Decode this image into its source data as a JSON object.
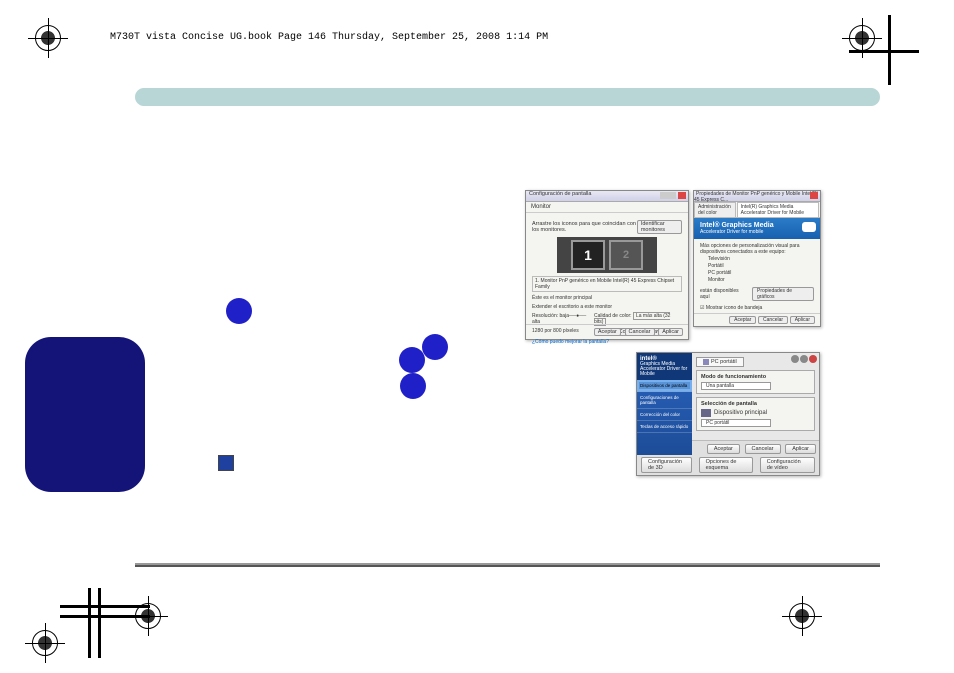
{
  "header": {
    "text": "M730T vista Concise UG.book  Page 146  Thursday, September 25, 2008  1:14 PM"
  },
  "callouts": {
    "n1": "",
    "n2": "",
    "n3": "",
    "n4": "",
    "n5": "",
    "n6": ""
  },
  "shot1": {
    "title": "Configuración de pantalla",
    "tab": "Monitor",
    "instruction": "Arrastre los iconos para que coincidan con los monitores.",
    "identify_btn": "Identificar monitores",
    "mon1": "1",
    "mon2": "2",
    "device_label": "1. Monitor PnP genérico en Mobile Intel(R) 45 Express Chipset Family",
    "main_checkbox": "Éste es el monitor principal",
    "extend_checkbox": "Extender el escritorio a este monitor",
    "res_label": "Resolución:",
    "res_low": "baja",
    "res_high": "alta",
    "res_value": "1280 por 800 píxeles",
    "color_label": "Calidad de color:",
    "color_value": "La más alta (32 bits)",
    "advanced_link": "¿Cómo puedo mejorar la pantalla?",
    "advanced_btn": "Configuración avanzada",
    "ok": "Aceptar",
    "cancel": "Cancelar",
    "apply": "Aplicar"
  },
  "shot2": {
    "title": "Propiedades de Monitor PnP genérico y Mobile Intel(R) 45 Express C...",
    "tab1": "Administración del color",
    "tab2": "Intel(R) Graphics Media Accelerator Driver for Mobile",
    "banner_line1": "Intel® Graphics Media",
    "banner_line2": "Accelerator Driver for mobile",
    "body_intro": "Más opciones de personalización visual para dispositivos conectados a este equipo:",
    "item1": "Televisión",
    "item2": "Portátil",
    "item3": "PC portátil",
    "item4": "Monitor",
    "props_label": "están disponibles aquí",
    "props_btn": "Propiedades de gráficos",
    "tray_check": "Mostrar icono de bandeja",
    "ok": "Aceptar",
    "cancel": "Cancelar",
    "apply": "Aplicar"
  },
  "shot3": {
    "brand1": "intel®",
    "brand2": "Graphics Media",
    "brand3": "Accelerator Driver for Mobile",
    "nav1": "Dispositivos de pantalla",
    "nav2": "Configuraciones de pantalla",
    "nav3": "Corrección del color",
    "nav4": "Teclas de acceso rápido",
    "tab_icon": "",
    "tab": "PC portátil",
    "group1_title": "Modo de funcionamiento",
    "mode_value": "Una pantalla",
    "group2_title": "Selección de pantalla",
    "dev_primary_label": "Dispositivo principal",
    "dev_primary": "PC portátil",
    "btn_3d": "Configuración de 3D",
    "ok": "Aceptar",
    "cancel": "Cancelar",
    "apply": "Aplicar",
    "foot1": "Opciones de esquema",
    "foot2": "Configuración de vídeo"
  }
}
